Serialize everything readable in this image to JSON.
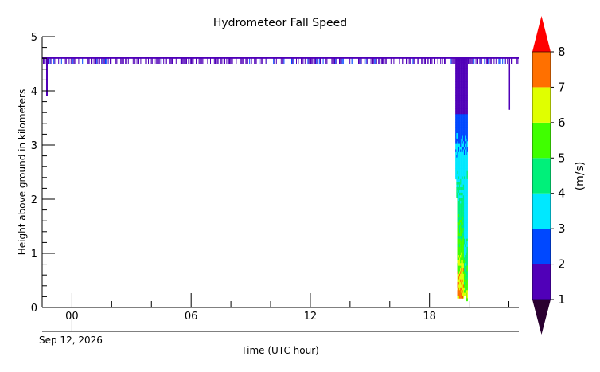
{
  "chart_data": {
    "type": "heatmap",
    "title": "Hydrometeor Fall Speed",
    "xlabel": "Time (UTC hour)",
    "ylabel": "Height above ground in kilometers",
    "date_label": "Sep 12, 2026",
    "x_range": [
      -1.5,
      22.5
    ],
    "y_range": [
      0,
      5
    ],
    "x_ticks": [
      {
        "value": 0,
        "label": "00"
      },
      {
        "value": 6,
        "label": "06"
      },
      {
        "value": 12,
        "label": "12"
      },
      {
        "value": 18,
        "label": "18"
      }
    ],
    "y_ticks": [
      {
        "value": 0,
        "label": "0"
      },
      {
        "value": 1,
        "label": "1"
      },
      {
        "value": 2,
        "label": "2"
      },
      {
        "value": 3,
        "label": "3"
      },
      {
        "value": 4,
        "label": "4"
      },
      {
        "value": 5,
        "label": "5"
      }
    ],
    "colorbar": {
      "label": "(m/s)",
      "ticks": [
        "1",
        "2",
        "3",
        "4",
        "5",
        "6",
        "7",
        "8"
      ],
      "min": 1,
      "max": 8,
      "colors": [
        "#5000b8",
        "#0048ff",
        "#00e8ff",
        "#00f07a",
        "#40ff00",
        "#e0ff00",
        "#ff7000"
      ],
      "under_color": "#2a0030",
      "over_color": "#ff0000"
    },
    "features": {
      "top_band": {
        "height_km_min": 4.5,
        "height_km_max": 4.62,
        "speed_ms": 1.4
      },
      "precip_column": {
        "time_start_h": 19.3,
        "time_end_h": 19.9,
        "height_km_max": 4.62
      },
      "small_echo_2150": {
        "time_h": 22.0,
        "height_km_min": 3.65,
        "height_km_max": 4.62
      },
      "small_echo_0000": {
        "time_h": -1.3,
        "height_km_min": 3.9,
        "height_km_max": 4.62
      }
    }
  }
}
